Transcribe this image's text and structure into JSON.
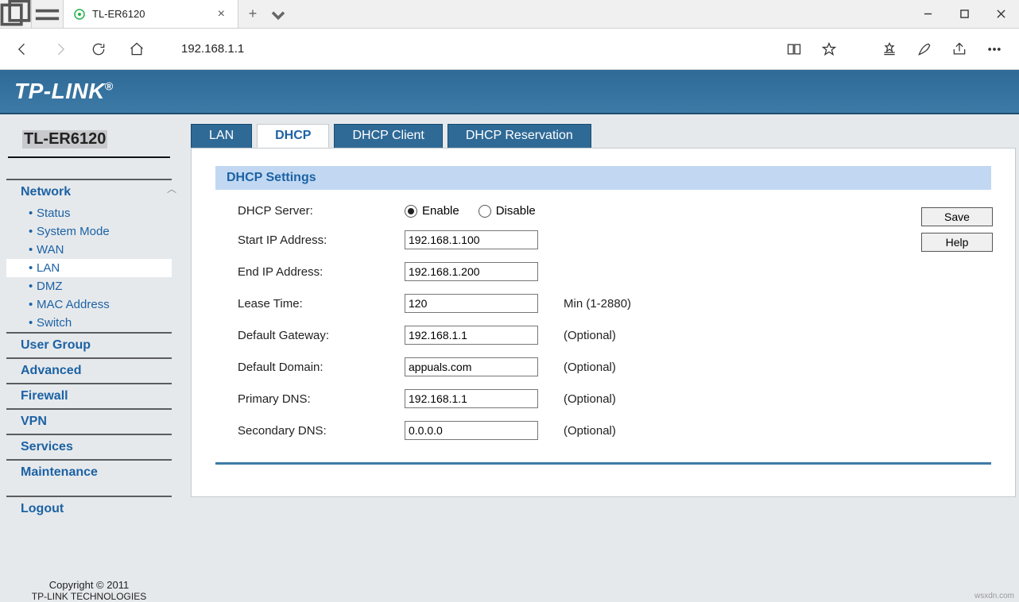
{
  "browser": {
    "tab_title": "TL-ER6120",
    "url": "192.168.1.1"
  },
  "brand": "TP-LINK",
  "model": "TL-ER6120",
  "sidebar": {
    "network": {
      "label": "Network",
      "items": [
        "Status",
        "System Mode",
        "WAN",
        "LAN",
        "DMZ",
        "MAC Address",
        "Switch"
      ]
    },
    "groups": [
      "User Group",
      "Advanced",
      "Firewall",
      "VPN",
      "Services",
      "Maintenance"
    ],
    "logout": "Logout",
    "copyright_line1": "Copyright © 2011",
    "copyright_line2": "TP-LINK TECHNOLOGIES"
  },
  "tabs": [
    "LAN",
    "DHCP",
    "DHCP Client",
    "DHCP Reservation"
  ],
  "section_title": "DHCP Settings",
  "form": {
    "dhcp_server_label": "DHCP Server:",
    "enable": "Enable",
    "disable": "Disable",
    "start_ip_label": "Start IP Address:",
    "start_ip": "192.168.1.100",
    "end_ip_label": "End IP Address:",
    "end_ip": "192.168.1.200",
    "lease_label": "Lease Time:",
    "lease": "120",
    "lease_hint": "Min (1-2880)",
    "gateway_label": "Default Gateway:",
    "gateway": "192.168.1.1",
    "domain_label": "Default Domain:",
    "domain": "appuals.com",
    "pdns_label": "Primary DNS:",
    "pdns": "192.168.1.1",
    "sdns_label": "Secondary DNS:",
    "sdns": "0.0.0.0",
    "optional": "(Optional)"
  },
  "buttons": {
    "save": "Save",
    "help": "Help"
  },
  "watermark": "wsxdn.com"
}
